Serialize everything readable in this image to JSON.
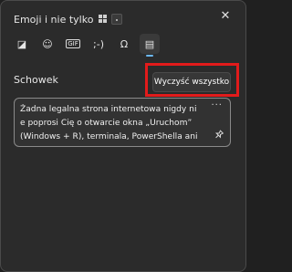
{
  "window": {
    "title": "Emoji i nie tylko",
    "close_label": "✕"
  },
  "tabs": [
    {
      "name": "recent-stickers",
      "glyph": "◪"
    },
    {
      "name": "emoji",
      "glyph": "☺"
    },
    {
      "name": "gif",
      "glyph": "GIF"
    },
    {
      "name": "kaomoji",
      "glyph": ";-)"
    },
    {
      "name": "symbols",
      "glyph": "Ω"
    },
    {
      "name": "clipboard",
      "glyph": "▤"
    }
  ],
  "clipboard": {
    "section_label": "Schowek",
    "clear_all_label": "Wyczyść wszystko",
    "items": [
      {
        "lines": [
          "Żadna legalna strona internetowa nigdy ni",
          "e poprosi Cię o otwarcie okna „Uruchom”",
          "(Windows + R), terminala, PowerShella ani"
        ],
        "more_label": "···",
        "pin_label": "📌"
      }
    ]
  },
  "colors": {
    "accent": "#6cb8f6",
    "highlight": "#e21b1b",
    "background": "#2b2b2b"
  }
}
